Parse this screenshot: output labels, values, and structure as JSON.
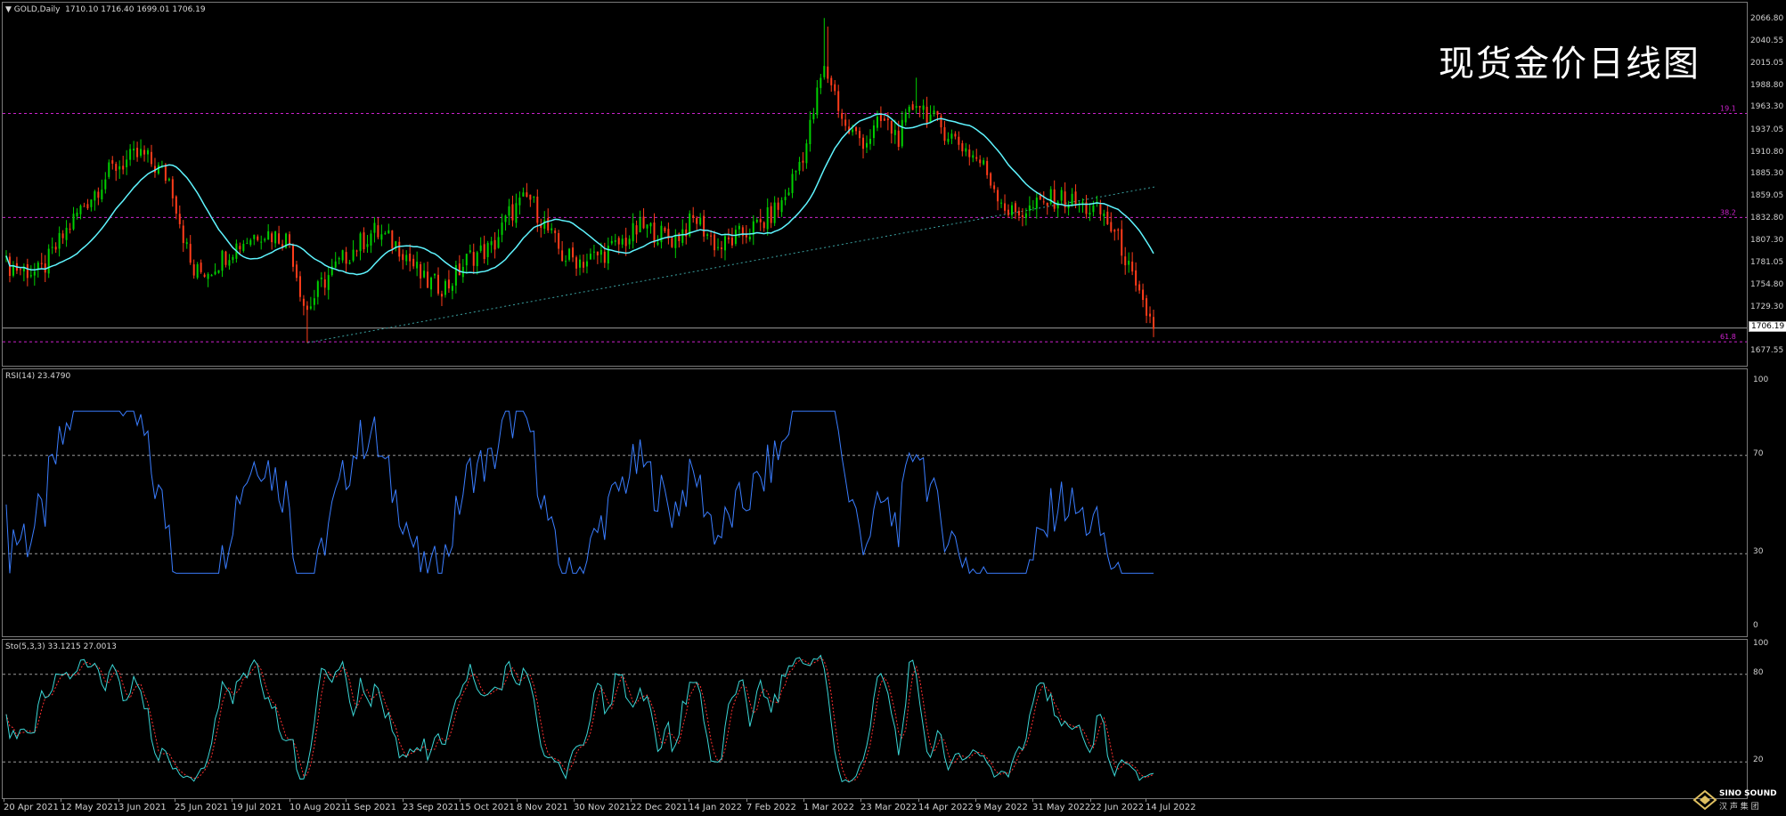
{
  "symbol_header": {
    "symbol": "GOLD,Daily",
    "ohlc": "1710.10 1716.40 1699.01 1706.19"
  },
  "overlay_title": "现货金价日线图",
  "price_axis": {
    "labels": [
      "2066.80",
      "2040.55",
      "2015.05",
      "1988.80",
      "1963.30",
      "1937.05",
      "1910.80",
      "1885.30",
      "1859.05",
      "1832.80",
      "1807.30",
      "1781.05",
      "1754.80",
      "1729.30",
      "1677.55"
    ],
    "current_price": "1706.19",
    "range": [
      1662,
      2088
    ]
  },
  "fib_levels": [
    {
      "label": "19.1",
      "value": 1958
    },
    {
      "label": "38.2",
      "value": 1836
    },
    {
      "label": "61.8",
      "value": 1690
    }
  ],
  "rsi": {
    "label": "RSI(14) 23.4790",
    "levels": [
      "100",
      "70",
      "30",
      "0"
    ]
  },
  "stoch": {
    "label": "Sto(5,3,3) 33.1215 27.0013",
    "levels": [
      "100",
      "80",
      "20"
    ]
  },
  "dates": [
    "20 Apr 2021",
    "12 May 2021",
    "3 Jun 2021",
    "25 Jun 2021",
    "19 Jul 2021",
    "10 Aug 2021",
    "1 Sep 2021",
    "23 Sep 2021",
    "15 Oct 2021",
    "8 Nov 2021",
    "30 Nov 2021",
    "22 Dec 2021",
    "14 Jan 2022",
    "7 Feb 2022",
    "1 Mar 2022",
    "23 Mar 2022",
    "14 Apr 2022",
    "9 May 2022",
    "31 May 2022",
    "22 Jun 2022",
    "14 Jul 2022"
  ],
  "logo_text": "SINO SOUND",
  "logo_sub": "汉 声 集 团",
  "colors": {
    "bull": "#00d000",
    "bear": "#ff3c1a",
    "ma": "#5ff5ff",
    "rsi": "#3a7dff",
    "stoch_main": "#3ad6d6",
    "stoch_signal": "#ff3030",
    "fib": "#cc22cc"
  }
}
